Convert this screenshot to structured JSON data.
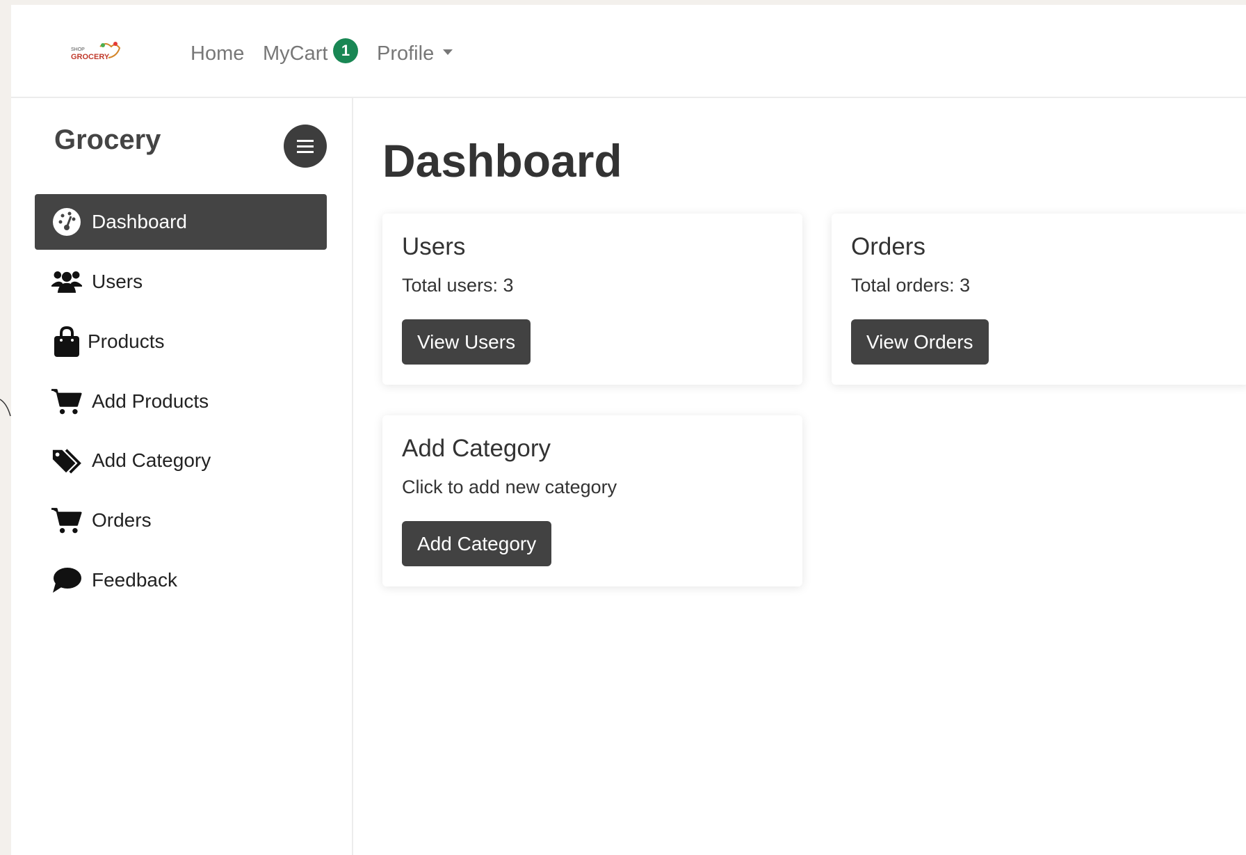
{
  "navbar": {
    "logo_top": "SHOP",
    "logo_text": "GROCERY",
    "home_label": "Home",
    "cart_label": "MyCart",
    "cart_count": "1",
    "profile_label": "Profile"
  },
  "sidebar": {
    "brand": "Grocery",
    "items": [
      {
        "label": "Dashboard",
        "icon": "dashboard-gauge-icon",
        "active": true
      },
      {
        "label": "Users",
        "icon": "users-icon"
      },
      {
        "label": "Products",
        "icon": "shopping-bag-icon"
      },
      {
        "label": "Add Products",
        "icon": "cart-icon"
      },
      {
        "label": "Add Category",
        "icon": "tags-icon"
      },
      {
        "label": "Orders",
        "icon": "cart-icon"
      },
      {
        "label": "Feedback",
        "icon": "comment-icon"
      }
    ]
  },
  "main": {
    "title": "Dashboard",
    "cards": [
      {
        "title": "Users",
        "text": "Total users: 3",
        "button": "View Users"
      },
      {
        "title": "Orders",
        "text": "Total orders: 3",
        "button": "View Orders"
      },
      {
        "title": "Add Category",
        "text": "Click to add new category",
        "button": "Add Category"
      }
    ]
  },
  "colors": {
    "accent_dark": "#424242",
    "badge_green": "#198754",
    "background": "#f3f0ec"
  }
}
